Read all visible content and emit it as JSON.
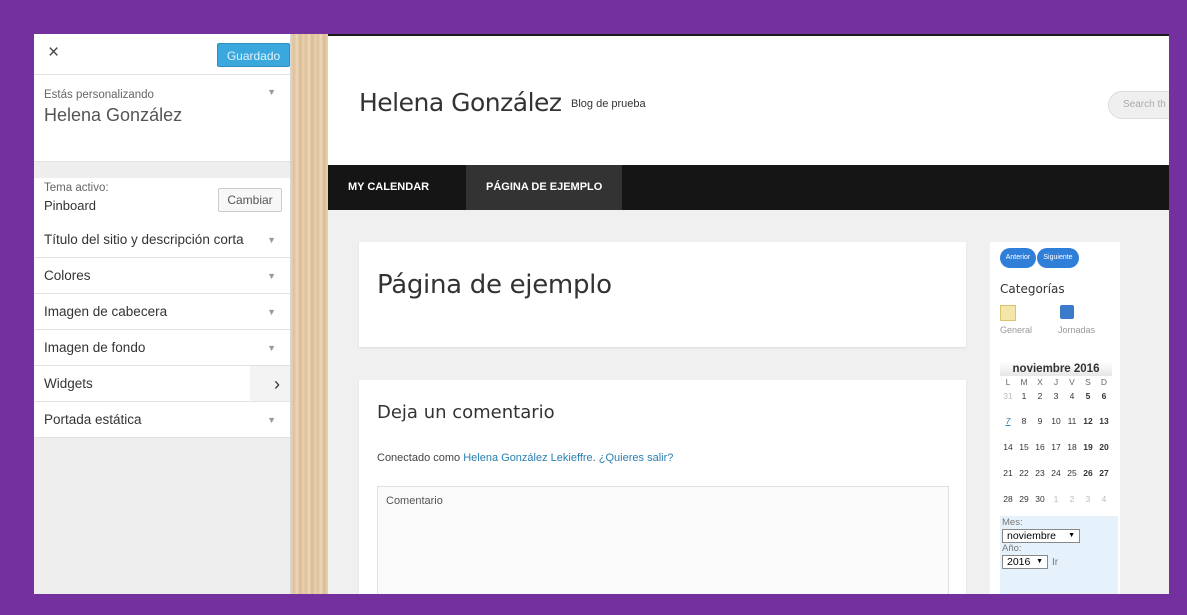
{
  "customizer": {
    "close_symbol": "×",
    "saved_label": "Guardado",
    "customizing_label": "Estás personalizando",
    "site_name": "Helena González",
    "active_theme_label": "Tema activo:",
    "active_theme_name": "Pinboard",
    "change_label": "Cambiar",
    "sections": [
      {
        "label": "Título del sitio y descripción corta"
      },
      {
        "label": "Colores"
      },
      {
        "label": "Imagen de cabecera"
      },
      {
        "label": "Imagen de fondo"
      },
      {
        "label": "Widgets"
      },
      {
        "label": "Portada estática"
      }
    ]
  },
  "site": {
    "title": "Helena González",
    "tagline": "Blog de prueba",
    "search_placeholder": "Search th",
    "nav": [
      {
        "label": "MY CALENDAR"
      },
      {
        "label": "PÁGINA DE EJEMPLO"
      }
    ],
    "page_title": "Página de ejemplo",
    "comment_title": "Deja un comentario",
    "logged_prefix": "Conectado como ",
    "logged_user": "Helena González Lekieffre",
    "logout_link": "¿Quieres salir?",
    "comment_placeholder": "Comentario"
  },
  "widget": {
    "prev_label": "Anterior",
    "next_label": "Siguiente",
    "categories_title": "Categorías",
    "categories": [
      {
        "label": "General"
      },
      {
        "label": "Jornadas"
      }
    ],
    "calendar": {
      "title": "noviembre 2016",
      "weekdays": [
        "L",
        "M",
        "X",
        "J",
        "V",
        "S",
        "D"
      ],
      "rows": [
        [
          "31",
          "1",
          "2",
          "3",
          "4",
          "5",
          "6"
        ],
        [
          "7",
          "8",
          "9",
          "10",
          "11",
          "12",
          "13"
        ],
        [
          "14",
          "15",
          "16",
          "17",
          "18",
          "19",
          "20"
        ],
        [
          "21",
          "22",
          "23",
          "24",
          "25",
          "26",
          "27"
        ],
        [
          "28",
          "29",
          "30",
          "1",
          "2",
          "3",
          "4"
        ]
      ]
    },
    "month_label": "Mes:",
    "month_value": "noviembre",
    "year_label": "Año:",
    "year_value": "2016",
    "go_label": "Ir"
  },
  "colors": {
    "frame": "#7530a0",
    "accent_blue": "#3aa8dd",
    "nav_bg": "#151515",
    "link": "#2a7fb0"
  }
}
